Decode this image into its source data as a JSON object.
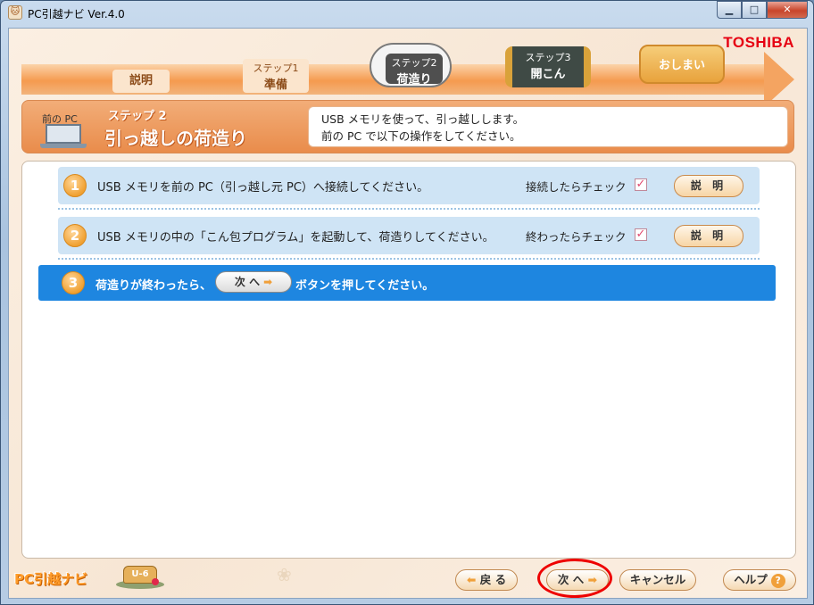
{
  "window": {
    "title": "PC引越ナビ Ver.4.0",
    "app_icon_glyph": "🐱",
    "min_glyph": "▁",
    "max_glyph": "□",
    "close_glyph": "✕"
  },
  "brand": "TOSHIBA",
  "progress": {
    "steps": [
      {
        "label": "説明"
      },
      {
        "line1": "ステップ1",
        "line2": "準備"
      },
      {
        "line1": "ステップ2",
        "line2": "荷造り",
        "current": true
      },
      {
        "line1": "ステップ3",
        "line2": "開こん"
      },
      {
        "label": "おしまい"
      }
    ]
  },
  "header": {
    "pc_label": "前の PC",
    "step_sub": "ステップ 2",
    "step_title": "引っ越しの荷造り",
    "desc_line1": "USB メモリを使って、引っ越しします。",
    "desc_line2": "前の PC で以下の操作をしてください。"
  },
  "instructions": [
    {
      "num": "1",
      "text": "USB メモリを前の PC（引っ越し元 PC）へ接続してください。",
      "check_label": "接続したらチェック",
      "checked": "✓",
      "button": "説 明"
    },
    {
      "num": "2",
      "text": "USB メモリの中の「こん包プログラム」を起動して、荷造りしてください。",
      "check_label": "終わったらチェック",
      "checked": "✓",
      "button": "説 明"
    }
  ],
  "final_step": {
    "num": "3",
    "text_before": "荷造りが終わったら、",
    "button": "次 へ",
    "arrow": "➡",
    "text_after": "ボタンを押してください。"
  },
  "footer": {
    "logo": "PC引越ナビ",
    "mascot": "U-6",
    "back": "戻 る",
    "back_arrow": "⬅",
    "next": "次 へ",
    "next_arrow": "➡",
    "cancel": "キャンセル",
    "help": "ヘルプ",
    "help_q": "?"
  },
  "colors": {
    "accent_orange": "#f59a4f",
    "highlight_blue": "#1e86e0",
    "row_blue": "#cfe4f5",
    "annotation_red": "#e00000",
    "brand_red": "#e60012"
  }
}
